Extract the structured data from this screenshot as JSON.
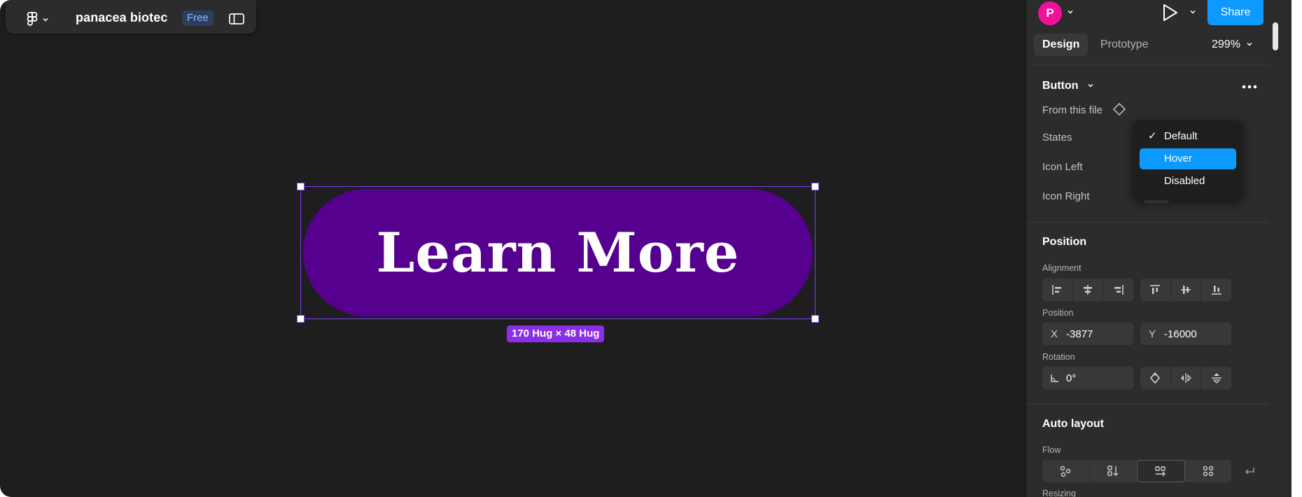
{
  "toolbar": {
    "file_name": "panacea biotec",
    "plan_badge": "Free"
  },
  "canvas": {
    "button_text": "Learn More",
    "size_label": "170 Hug × 48 Hug",
    "button_fill": "#55008f",
    "selection_color": "#7b3ff2"
  },
  "header": {
    "avatar_initial": "P",
    "share_label": "Share",
    "tabs": [
      "Design",
      "Prototype"
    ],
    "zoom": "299%"
  },
  "component": {
    "title": "Button",
    "source": "From this file",
    "props": [
      "States",
      "Icon Left",
      "Icon Right"
    ],
    "states_menu": [
      "Default",
      "Hover",
      "Disabled"
    ],
    "checked": "Default",
    "highlighted": "Hover"
  },
  "position": {
    "title": "Position",
    "alignment_label": "Alignment",
    "position_label": "Position",
    "x_prefix": "X",
    "x_value": "-3877",
    "y_prefix": "Y",
    "y_value": "-16000",
    "rotation_label": "Rotation",
    "rotation_value": "0°"
  },
  "auto_layout": {
    "title": "Auto layout",
    "flow_label": "Flow",
    "resizing_label": "Resizing"
  },
  "colors": {
    "accent": "#0d99ff",
    "avatar": "#f0109a",
    "badge_text": "#8cb8ff"
  }
}
